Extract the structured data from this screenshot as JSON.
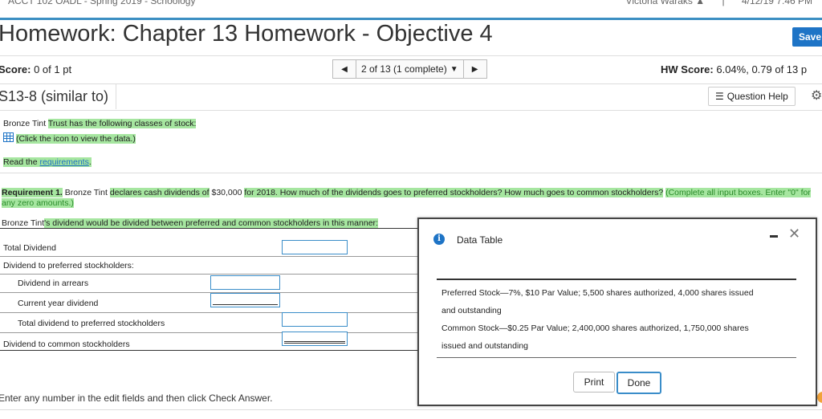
{
  "topbar": {
    "course_title": "ACCT 102 OADL - Spring 2019 - Schoology",
    "user_name": "Victoria Waraks",
    "datetime": "4/12/19 7:46 PM"
  },
  "header": {
    "title": "Homework: Chapter 13 Homework - Objective 4",
    "save_label": "Save"
  },
  "scorebar": {
    "score_label": "Score:",
    "score_value": "0 of 1 pt",
    "nav_text": "2 of 13 (1 complete)",
    "hw_score_label": "HW Score:",
    "hw_score_value": "6.04%, 0.79 of 13 p"
  },
  "question": {
    "id": "S13-8 (similar to)",
    "help_label": "Question Help"
  },
  "content": {
    "intro_company": "Bronze Tint",
    "intro_rest": "Trust has the following classes of stock:",
    "data_link": "(Click the icon to view the data.)",
    "read_prefix": "Read the",
    "read_link": "requirements",
    "read_suffix": ".",
    "req_label": "Requirement 1.",
    "req_company": "Bronze Tint",
    "req_text1": "declares cash dividends of",
    "req_amount": "$30,000",
    "req_text2": "for 2018",
    "req_text3": ". How much of the dividends goes to preferred stockholders? How much goes to common stockholders?",
    "req_note": "(Complete all input boxes. Enter \"0\" for any zero amounts.)",
    "lead_company": "Bronze Tint",
    "lead_text": "'s dividend would be divided between preferred and common stockholders in this manner:"
  },
  "form": {
    "rows": [
      {
        "label": "Total Dividend"
      },
      {
        "label": "Dividend to preferred stockholders:"
      },
      {
        "label": "Dividend in arrears"
      },
      {
        "label": "Current year dividend"
      },
      {
        "label": "Total dividend to preferred stockholders"
      },
      {
        "label": "Dividend to common stockholders"
      }
    ]
  },
  "footer": {
    "instruction": "Enter any number in the edit fields and then click Check Answer."
  },
  "dialog": {
    "title": "Data Table",
    "line1": "Preferred Stock—7%, $10 Par Value; 5,500 shares authorized, 4,000 shares issued",
    "line2": "and outstanding",
    "line3": "Common Stock—$0.25 Par Value; 2,400,000 shares authorized, 1,750,000 shares",
    "line4": "issued and outstanding",
    "print_label": "Print",
    "done_label": "Done"
  }
}
